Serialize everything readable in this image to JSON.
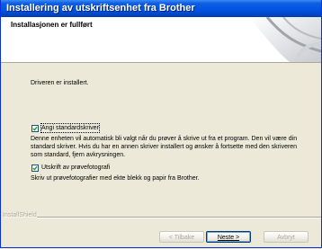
{
  "window": {
    "title": "Installering av utskriftsenhet fra Brother"
  },
  "header": {
    "title": "Installasjonen er fullført"
  },
  "main": {
    "driver_installed": "Driveren er installert.",
    "option_default": {
      "label": "Angi standardskriver",
      "checked": true,
      "description": "Denne enheten vil automatisk bli valgt når du prøver å skrive ut fra et program. Den vil være din standard skriver. Hvis du har en annen skriver installert og ønsker å fortsette med den skriveren som standard, fjern avkrysningen."
    },
    "option_test": {
      "label": "Utskrift av prøvefotografi",
      "checked": true,
      "description": "Skriv ut prøvefotografier med ekte blekk og papir fra Brother."
    }
  },
  "footer": {
    "brand": "InstallShield",
    "back_label": "< Tilbake",
    "next_label": "Neste >",
    "cancel_label": "Avbryt"
  }
}
